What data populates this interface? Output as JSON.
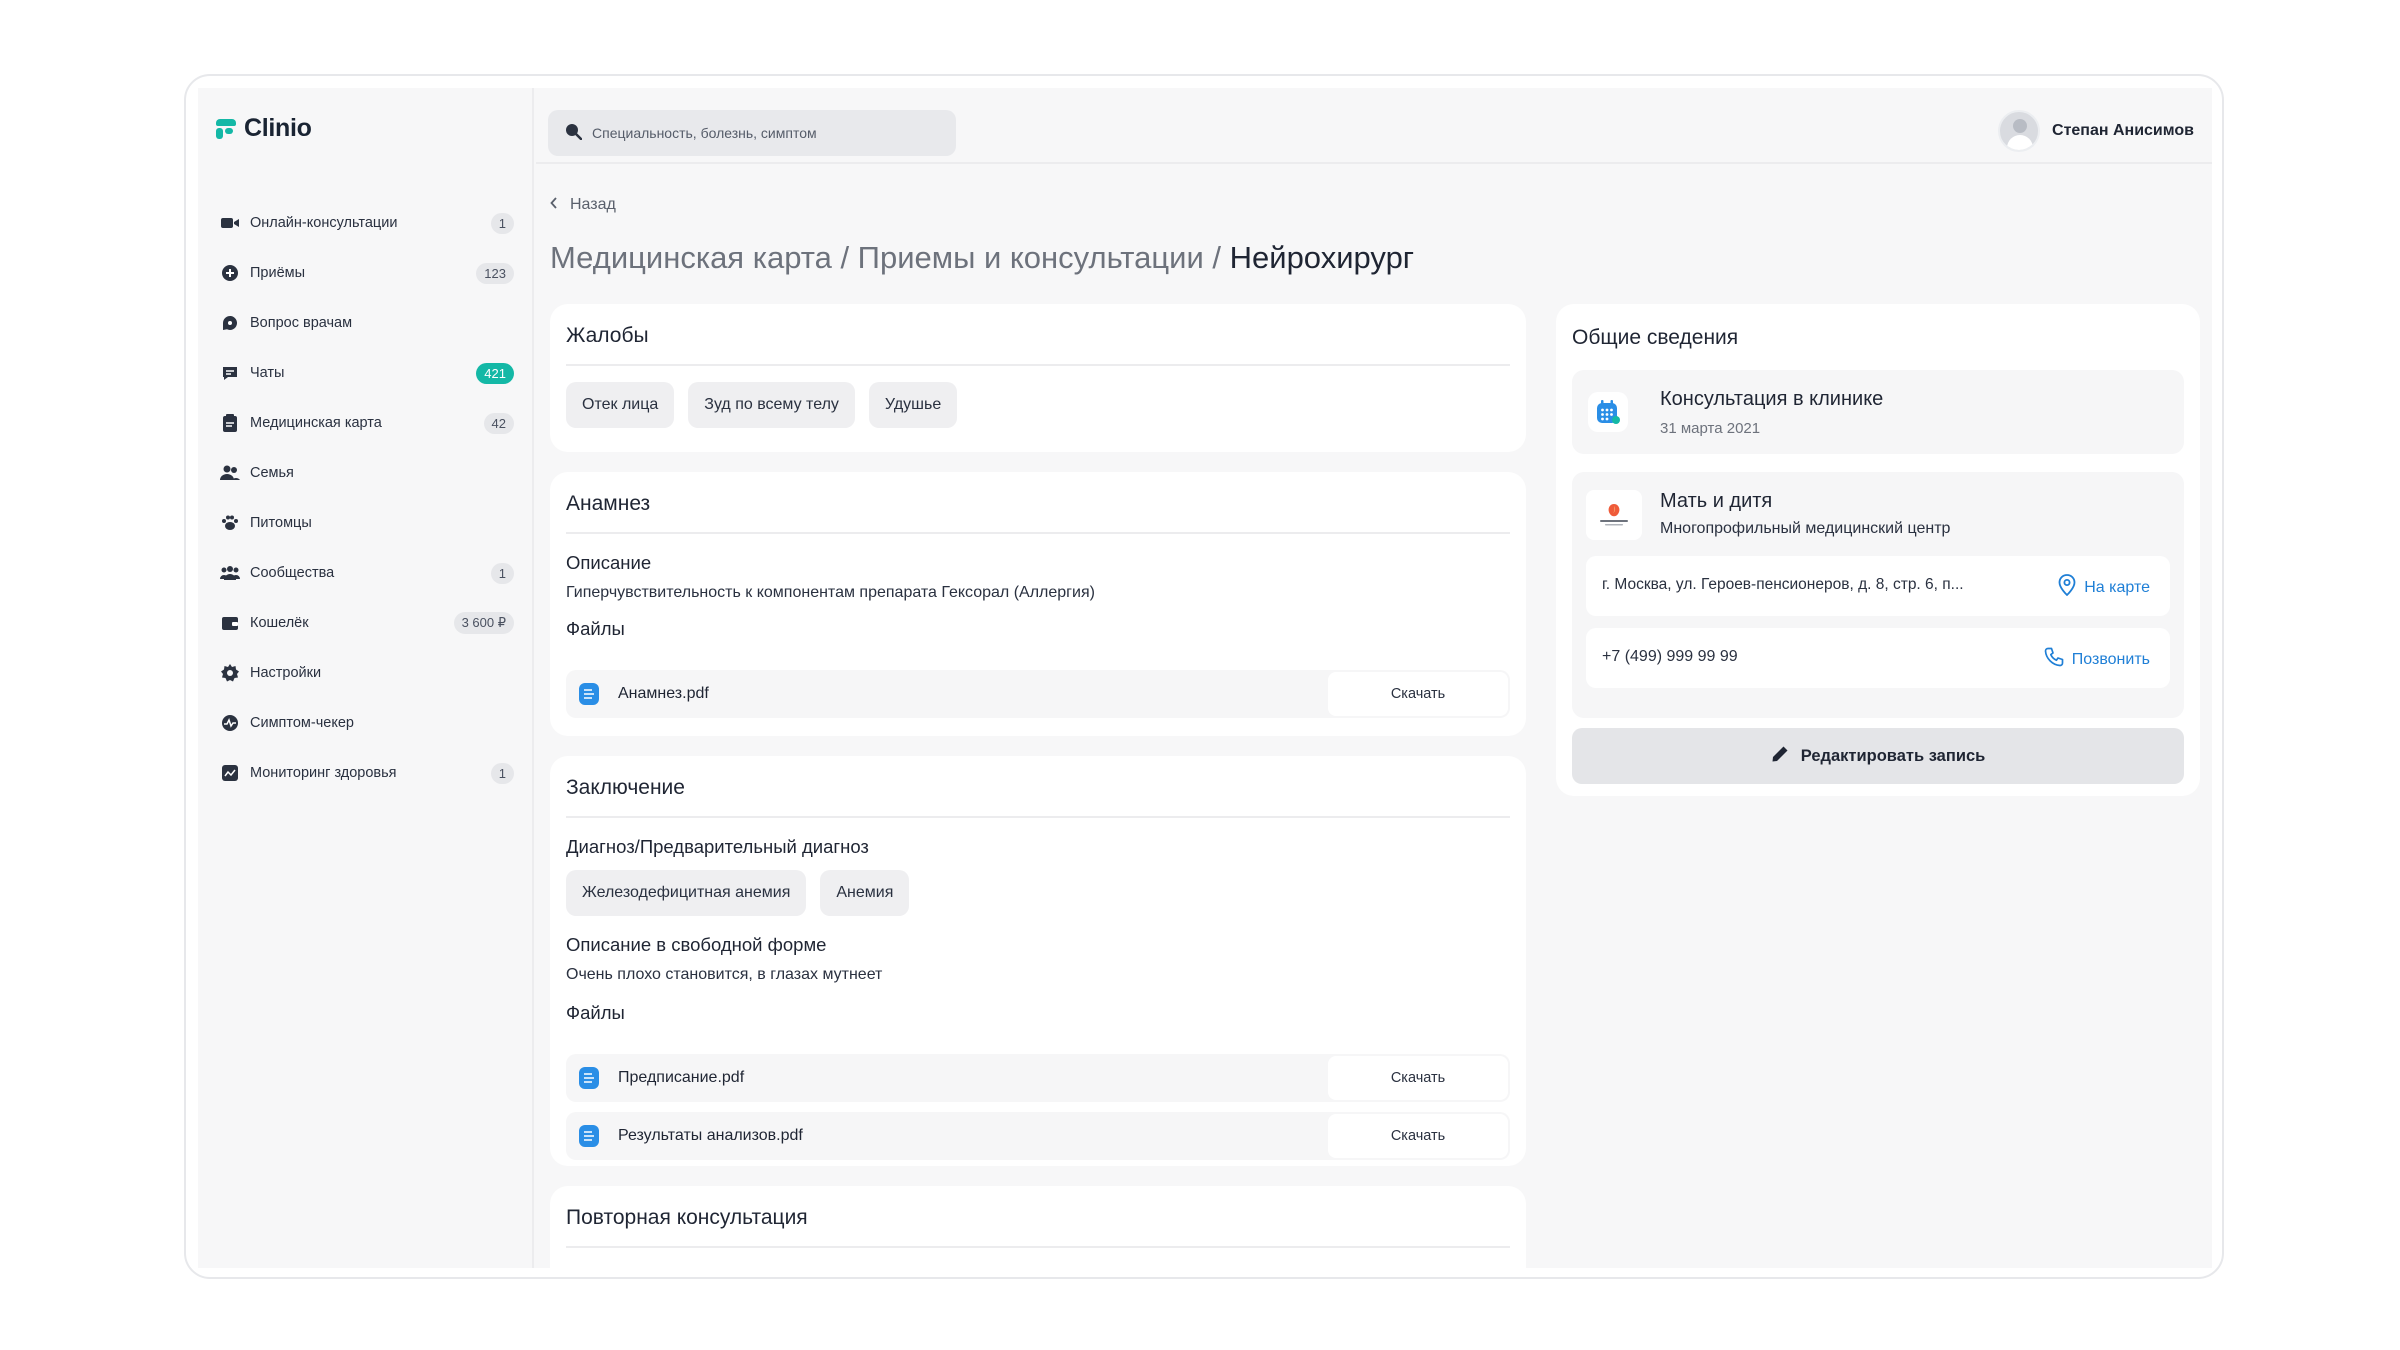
{
  "app": {
    "logo_text": "Clinio",
    "brand_color": "#14b8a6"
  },
  "sidebar": {
    "items": [
      {
        "label": "Онлайн-консультации",
        "badge": "1",
        "icon": "video-icon"
      },
      {
        "label": "Приёмы",
        "badge": "123",
        "icon": "clinic-icon"
      },
      {
        "label": "Вопрос врачам",
        "badge": "",
        "icon": "question-icon"
      },
      {
        "label": "Чаты",
        "badge": "421",
        "icon": "chat-icon"
      },
      {
        "label": "Медицинская карта",
        "badge": "42",
        "icon": "clipboard-icon"
      },
      {
        "label": "Семья",
        "badge": "",
        "icon": "family-icon"
      },
      {
        "label": "Питомцы",
        "badge": "",
        "icon": "paw-icon"
      },
      {
        "label": "Сообщества",
        "badge": "1",
        "icon": "community-icon"
      },
      {
        "label": "Кошелёк",
        "badge": "3 600 ₽",
        "icon": "wallet-icon"
      },
      {
        "label": "Настройки",
        "badge": "",
        "icon": "gear-icon"
      },
      {
        "label": "Симптом-чекер",
        "badge": "",
        "icon": "pulse-icon"
      },
      {
        "label": "Мониторинг здоровья",
        "badge": "1",
        "icon": "monitor-icon"
      }
    ]
  },
  "topbar": {
    "search_placeholder": "Специальность, болезнь, симптом",
    "user_name": "Степан Анисимов"
  },
  "main": {
    "back_label": "Назад",
    "breadcrumb_prefix": "Медицинская карта / Приемы и консультации / ",
    "breadcrumb_current": "Нейрохирург",
    "complaints": {
      "title": "Жалобы",
      "chips": [
        "Отек лица",
        "Зуд по всему телу",
        "Удушье"
      ]
    },
    "anamnesis": {
      "title": "Анамнез",
      "desc_label": "Описание",
      "desc_text": "Гиперчувствительность к компонентам препарата Гексорал (Аллергия)",
      "files_label": "Файлы",
      "files": [
        {
          "name": "Анамнез.pdf",
          "action": "Скачать"
        }
      ]
    },
    "conclusion": {
      "title": "Заключение",
      "diagnosis_label": "Диагноз/Предварительный диагноз",
      "diagnosis_chips": [
        "Железодефицитная анемия",
        "Анемия"
      ],
      "free_label": "Описание в свободной форме",
      "free_text": "Очень плохо становится, в глазах мутнеет",
      "files_label": "Файлы",
      "files": [
        {
          "name": "Предписание.pdf",
          "action": "Скачать"
        },
        {
          "name": "Результаты анализов.pdf",
          "action": "Скачать"
        }
      ]
    },
    "repeat": {
      "title": "Повторная консультация"
    }
  },
  "info": {
    "title": "Общие сведения",
    "visit_type": "Консультация в клинике",
    "visit_date": "31 марта 2021",
    "clinic_name": "Мать и дитя",
    "clinic_type": "Многопрофильный медицинский центр",
    "address": "г. Москва, ул. Героев-пенсионеров, д. 8, стр. 6, п...",
    "map_link": "На карте",
    "phone": "+7 (499) 999 99 99",
    "call_link": "Позвонить",
    "edit_button": "Редактировать запись",
    "link_color": "#1f7fd6"
  }
}
